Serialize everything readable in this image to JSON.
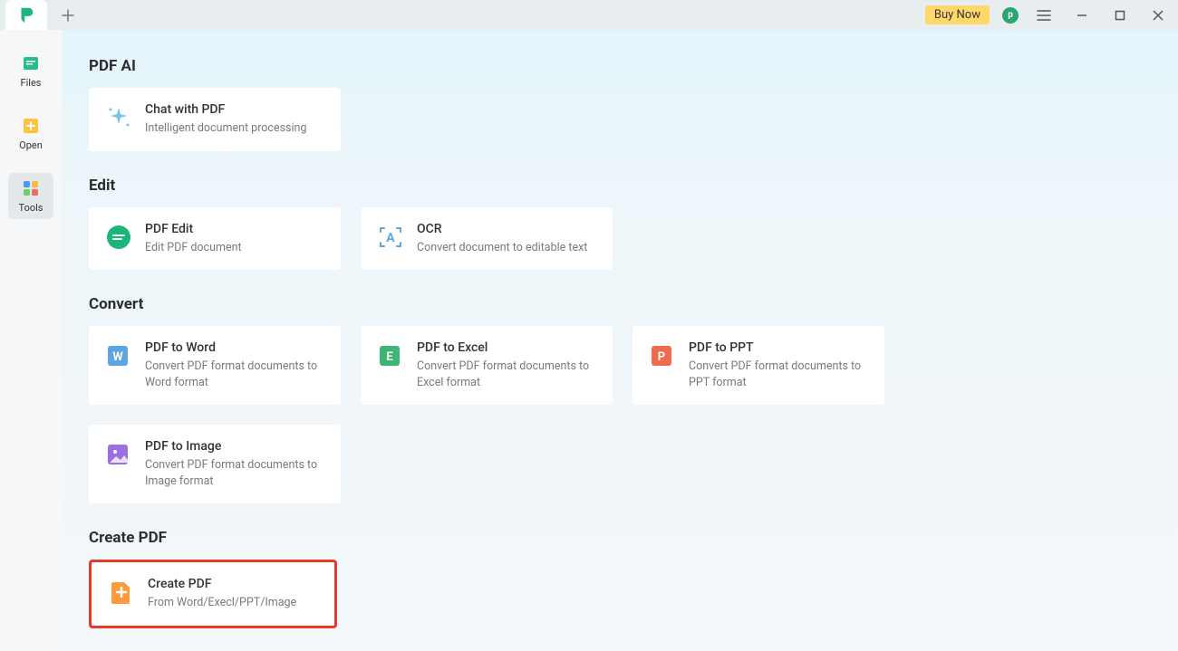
{
  "titlebar": {
    "buy_now": "Buy Now",
    "avatar_letter": "p"
  },
  "sidebar": {
    "items": [
      {
        "label": "Files"
      },
      {
        "label": "Open"
      },
      {
        "label": "Tools"
      }
    ]
  },
  "sections": {
    "pdf_ai": {
      "title": "PDF AI",
      "chat_title": "Chat with PDF",
      "chat_desc": "Intelligent document processing"
    },
    "edit": {
      "title": "Edit",
      "edit_title": "PDF Edit",
      "edit_desc": "Edit PDF document",
      "ocr_title": "OCR",
      "ocr_desc": "Convert document to editable text"
    },
    "convert": {
      "title": "Convert",
      "word_title": "PDF to Word",
      "word_desc": "Convert PDF format documents to Word format",
      "excel_title": "PDF to Excel",
      "excel_desc": "Convert PDF format documents to Excel format",
      "ppt_title": "PDF to PPT",
      "ppt_desc": "Convert PDF format documents to PPT format",
      "image_title": "PDF to Image",
      "image_desc": "Convert PDF format documents to Image format"
    },
    "create": {
      "title": "Create PDF",
      "create_title": "Create PDF",
      "create_desc": "From Word/Execl/PPT/Image"
    }
  }
}
